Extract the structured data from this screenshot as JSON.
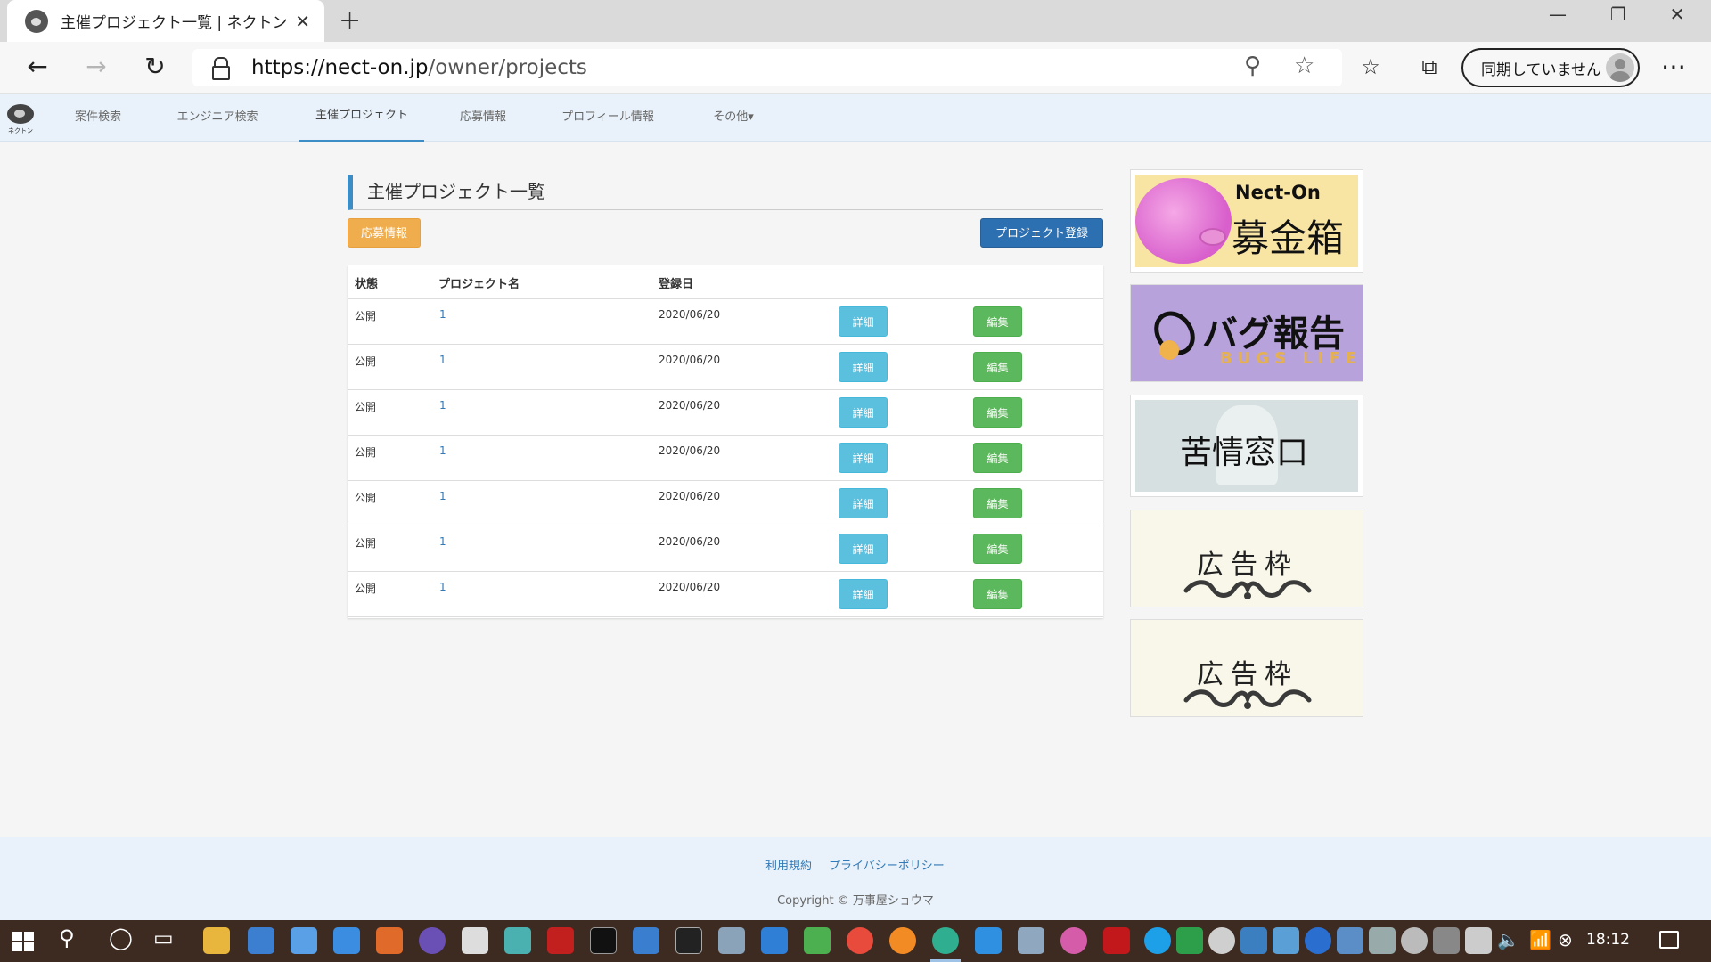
{
  "browser": {
    "tab_title": "主催プロジェクト一覧 | ネクトン",
    "url_host": "https://nect-on.jp",
    "url_path": "/owner/projects",
    "sync_label": "同期していません"
  },
  "site_nav": {
    "logo_text": "ネクトン",
    "items": [
      {
        "label": "案件検索"
      },
      {
        "label": "エンジニア検索"
      },
      {
        "label": "主催プロジェクト",
        "active": true
      },
      {
        "label": "応募情報"
      },
      {
        "label": "プロフィール情報"
      },
      {
        "label": "その他▾"
      }
    ]
  },
  "main": {
    "title": "主催プロジェクト一覧",
    "applications_button": "応募情報",
    "register_button": "プロジェクト登録",
    "table": {
      "headers": [
        "状態",
        "プロジェクト名",
        "登録日"
      ],
      "rows": [
        {
          "status": "公開",
          "name": "1",
          "date": "2020/06/20",
          "detail": "詳細",
          "edit": "編集"
        },
        {
          "status": "公開",
          "name": "1",
          "date": "2020/06/20",
          "detail": "詳細",
          "edit": "編集"
        },
        {
          "status": "公開",
          "name": "1",
          "date": "2020/06/20",
          "detail": "詳細",
          "edit": "編集"
        },
        {
          "status": "公開",
          "name": "1",
          "date": "2020/06/20",
          "detail": "詳細",
          "edit": "編集"
        },
        {
          "status": "公開",
          "name": "1",
          "date": "2020/06/20",
          "detail": "詳細",
          "edit": "編集"
        },
        {
          "status": "公開",
          "name": "1",
          "date": "2020/06/20",
          "detail": "詳細",
          "edit": "編集"
        },
        {
          "status": "公開",
          "name": "1",
          "date": "2020/06/20",
          "detail": "詳細",
          "edit": "編集"
        }
      ]
    }
  },
  "sidebar": {
    "donation_brand": "Nect-On",
    "donation_title": "募金箱",
    "bug_title": "バグ報告",
    "bug_subtitle": "BUGS LIFE",
    "complaint_title": "苦情窓口",
    "ad_labels": [
      "広告枠",
      "広告枠"
    ]
  },
  "footer": {
    "terms": "利用規約",
    "privacy": "プライバシーポリシー",
    "copyright": "Copyright © 万事屋ショウマ"
  },
  "taskbar": {
    "clock": "18:12"
  },
  "colors": {
    "accent": "#3c8dc5",
    "orange_button": "#efad4e",
    "blue_button": "#2c70b1",
    "info_button": "#5bc0de",
    "success_button": "#5cb85c",
    "nav_bg": "#e9f2fa",
    "taskbar_bg": "#3d2b22"
  }
}
